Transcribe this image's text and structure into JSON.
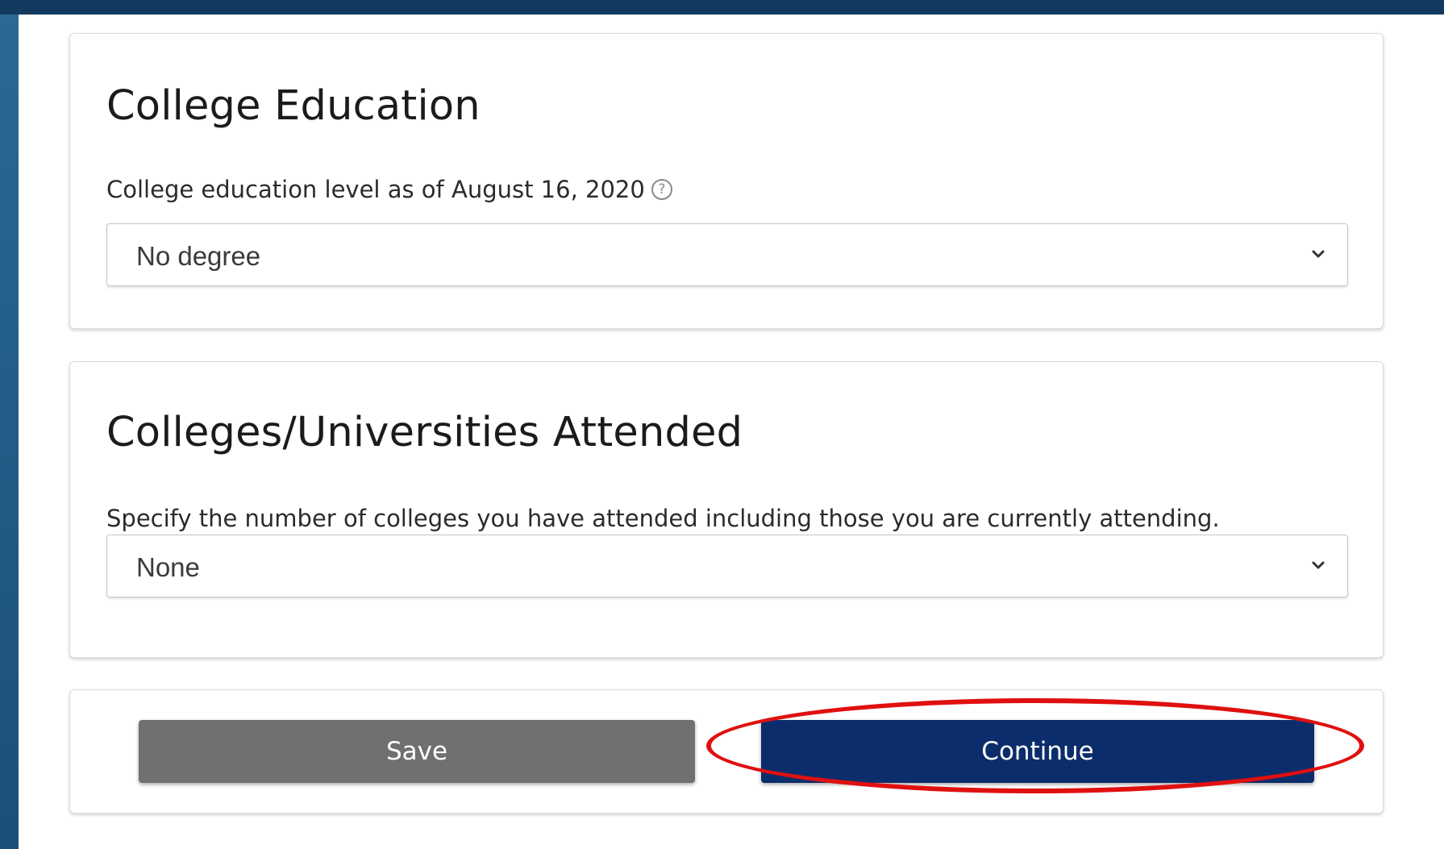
{
  "education": {
    "title": "College Education",
    "level_label": "College education level as of August 16, 2020",
    "help_symbol": "?",
    "level_value": "No degree"
  },
  "colleges": {
    "title": "Colleges/Universities Attended",
    "count_label": "Specify the number of colleges you have attended including those you are currently attending.",
    "count_value": "None"
  },
  "actions": {
    "save_label": "Save",
    "continue_label": "Continue"
  },
  "colors": {
    "save_button": "#707070",
    "continue_button": "#0c2d6b",
    "annotation_ring": "#e01010"
  },
  "icons": {
    "help": "question-circle-icon",
    "select_arrow": "chevron-down-icon"
  }
}
